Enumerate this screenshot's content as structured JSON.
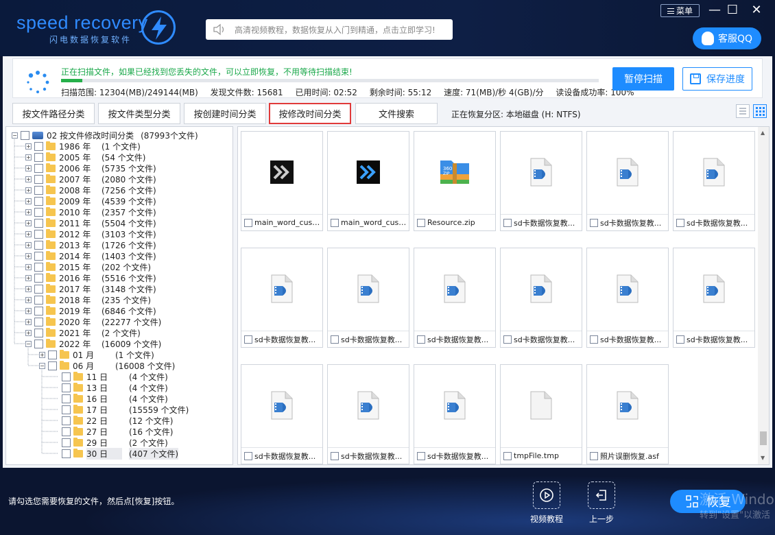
{
  "header": {
    "logo_text": "speed recovery",
    "logo_sub": "闪电数据恢复软件",
    "search_placeholder": "高清视频教程，数据恢复从入门到精通，点击立即学习!",
    "menu_label": "菜单",
    "qq_label": "客服QQ"
  },
  "status": {
    "message": "正在扫描文件，如果已经找到您丢失的文件，可以立即恢复，不用等待扫描结束!",
    "progress_percent": 4,
    "scan_range": "扫描范围: 12304(MB)/249144(MB)",
    "files_found": "发现文件数: 15681",
    "elapsed": "已用时间: 02:52",
    "remaining": "剩余时间: 55:12",
    "speed": "速度: 71(MB)/秒  4(GB)/分",
    "success_rate": "读设备成功率: 100%",
    "pause_label": "暂停扫描",
    "save_label": "保存进度"
  },
  "tabs": [
    {
      "label": "按文件路径分类"
    },
    {
      "label": "按文件类型分类"
    },
    {
      "label": "按创建时间分类"
    },
    {
      "label": "按修改时间分类",
      "active": true
    },
    {
      "label": "文件搜索"
    }
  ],
  "partition_label": "正在恢复分区: 本地磁盘 (H: NTFS)",
  "tree": {
    "root_name": "02  按文件修改时间分类",
    "root_count": "(87993个文件)",
    "years": [
      {
        "name": "1986 年",
        "count": "(1 个文件)"
      },
      {
        "name": "2005 年",
        "count": "(54 个文件)"
      },
      {
        "name": "2006 年",
        "count": "(5735 个文件)"
      },
      {
        "name": "2007 年",
        "count": "(2080 个文件)"
      },
      {
        "name": "2008 年",
        "count": "(7256 个文件)"
      },
      {
        "name": "2009 年",
        "count": "(4539 个文件)"
      },
      {
        "name": "2010 年",
        "count": "(2357 个文件)"
      },
      {
        "name": "2011 年",
        "count": "(5504 个文件)"
      },
      {
        "name": "2012 年",
        "count": "(3103 个文件)"
      },
      {
        "name": "2013 年",
        "count": "(1726 个文件)"
      },
      {
        "name": "2014 年",
        "count": "(1403 个文件)"
      },
      {
        "name": "2015 年",
        "count": "(202 个文件)"
      },
      {
        "name": "2016 年",
        "count": "(5516 个文件)"
      },
      {
        "name": "2017 年",
        "count": "(3148 个文件)"
      },
      {
        "name": "2018 年",
        "count": "(235 个文件)"
      },
      {
        "name": "2019 年",
        "count": "(6846 个文件)"
      },
      {
        "name": "2020 年",
        "count": "(22277 个文件)"
      },
      {
        "name": "2021 年",
        "count": "(2 个文件)"
      },
      {
        "name": "2022 年",
        "count": "(16009 个文件)"
      }
    ],
    "months": [
      {
        "name": "01 月",
        "count": "(1 个文件)"
      },
      {
        "name": "06 月",
        "count": "(16008 个文件)"
      }
    ],
    "days": [
      {
        "name": "11 日",
        "count": "(4 个文件)"
      },
      {
        "name": "13 日",
        "count": "(4 个文件)"
      },
      {
        "name": "16 日",
        "count": "(4 个文件)"
      },
      {
        "name": "17 日",
        "count": "(15559 个文件)"
      },
      {
        "name": "22 日",
        "count": "(12 个文件)"
      },
      {
        "name": "27 日",
        "count": "(16 个文件)"
      },
      {
        "name": "29 日",
        "count": "(2 个文件)"
      },
      {
        "name": "30 日",
        "count": "(407 个文件)"
      }
    ]
  },
  "files": [
    {
      "name": "main_word_custo...",
      "icon": "chevron-dark-icon"
    },
    {
      "name": "main_word_custo...",
      "icon": "chevron-blue-icon"
    },
    {
      "name": "Resource.zip",
      "icon": "zip-icon"
    },
    {
      "name": "sd卡数据恢复教...",
      "icon": "video-file-icon"
    },
    {
      "name": "sd卡数据恢复教...",
      "icon": "video-file-icon"
    },
    {
      "name": "sd卡数据恢复教...",
      "icon": "video-file-icon"
    },
    {
      "name": "sd卡数据恢复教...",
      "icon": "video-file-icon"
    },
    {
      "name": "sd卡数据恢复教...",
      "icon": "video-file-icon"
    },
    {
      "name": "sd卡数据恢复教...",
      "icon": "video-file-icon"
    },
    {
      "name": "sd卡数据恢复教...",
      "icon": "video-file-icon"
    },
    {
      "name": "sd卡数据恢复教...",
      "icon": "video-file-icon"
    },
    {
      "name": "sd卡数据恢复教...",
      "icon": "video-file-icon"
    },
    {
      "name": "sd卡数据恢复教...",
      "icon": "video-file-icon"
    },
    {
      "name": "sd卡数据恢复教...",
      "icon": "video-file-icon"
    },
    {
      "name": "sd卡数据恢复教...",
      "icon": "video-file-icon"
    },
    {
      "name": "tmpFile.tmp",
      "icon": "blank-file-icon"
    },
    {
      "name": "照片误删恢复.asf",
      "icon": "video-file-icon"
    }
  ],
  "footer": {
    "hint": "请勾选您需要恢复的文件，然后点[恢复]按钮。",
    "video_label": "视频教程",
    "back_label": "上一步",
    "recover_label": "恢复",
    "watermark_line1": "激活 Windo",
    "watermark_line2": "转到\"设置\"以激活"
  },
  "colors": {
    "accent": "#1e8cff",
    "progress": "#26b04a",
    "active_tab_border": "#e03a3a"
  }
}
